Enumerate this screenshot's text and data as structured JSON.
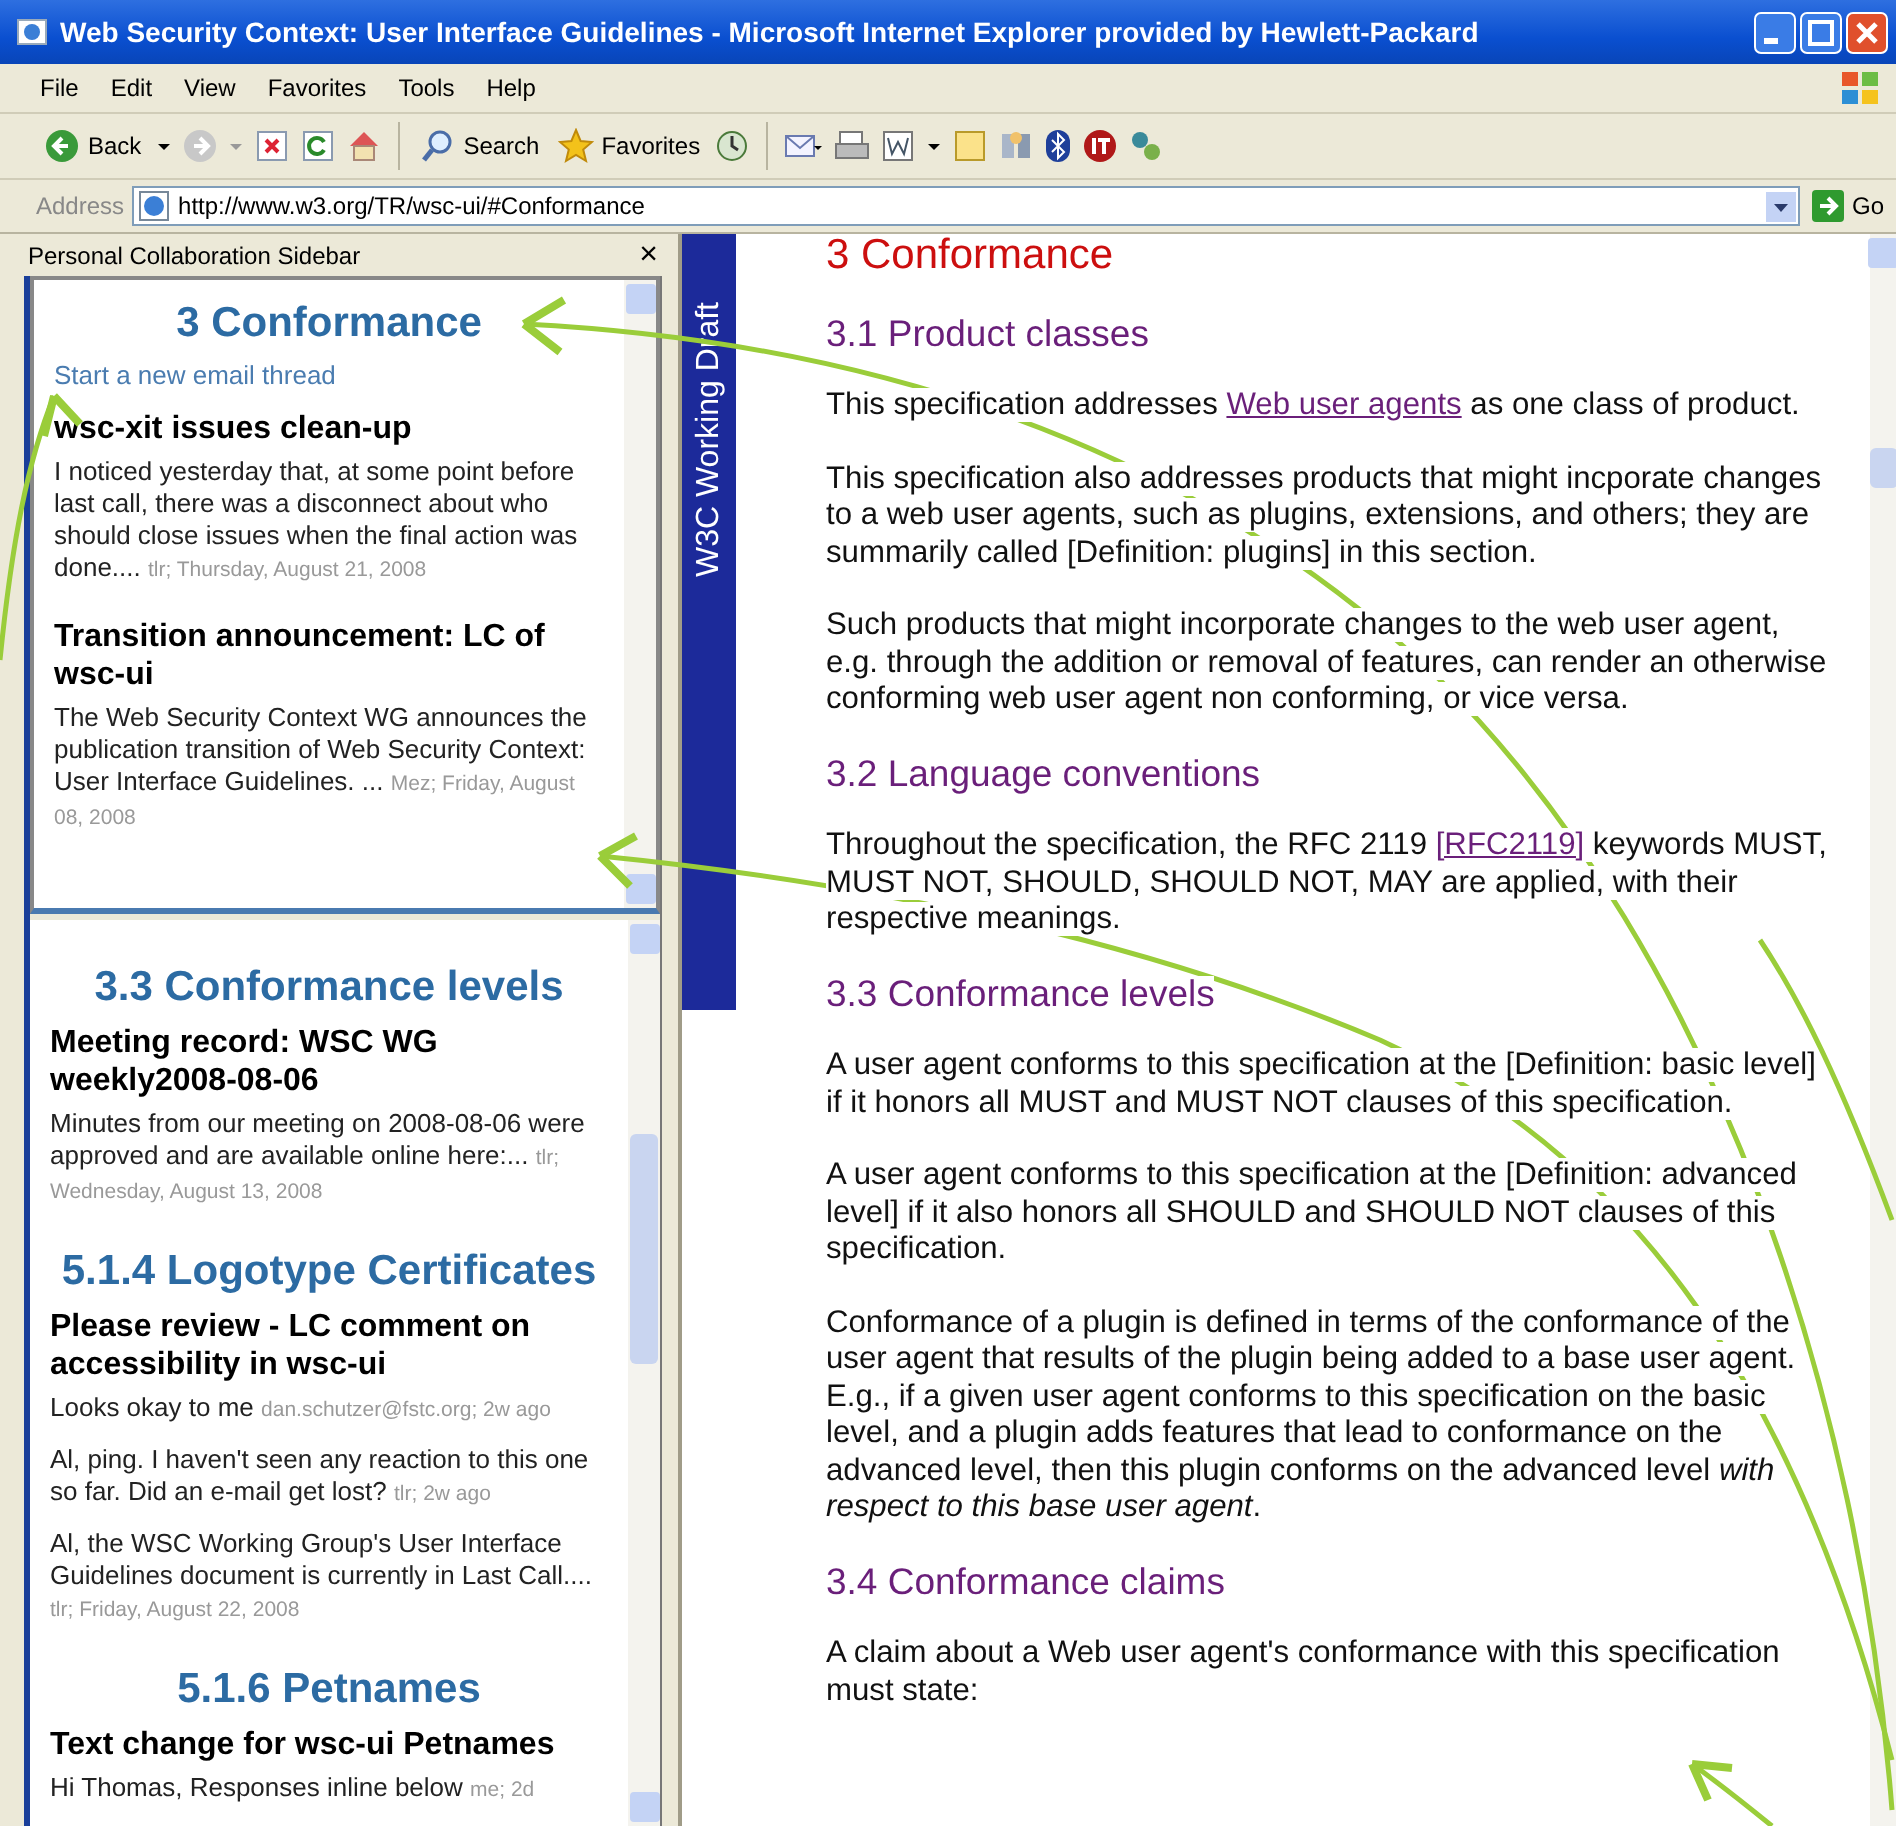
{
  "window": {
    "title": "Web Security Context: User Interface Guidelines - Microsoft Internet Explorer provided by Hewlett-Packard"
  },
  "menu_bar": [
    "File",
    "Edit",
    "View",
    "Favorites",
    "Tools",
    "Help"
  ],
  "toolbar": [
    {
      "kind": "back",
      "label": "Back"
    },
    {
      "kind": "search",
      "label": "Search"
    },
    {
      "kind": "favorites",
      "label": "Favorites"
    }
  ],
  "address_bar": {
    "label": "Address",
    "value": "http://www.w3.org/TR/wsc-ui/#Conformance",
    "go": "Go"
  },
  "sidebar": {
    "title": "Personal Collaboration Sidebar",
    "close": "×",
    "panes": [
      {
        "sections": [
          {
            "heading": "3 Conformance",
            "link": "Start a new email thread",
            "threads": [
              {
                "title": "wsc-xit issues clean-up",
                "messages": [
                  {
                    "text": "I noticed yesterday that, at some point before last call, there was a disconnect about who should close issues when the final action was done....",
                    "meta": "tlr; Thursday, August 21, 2008"
                  }
                ]
              },
              {
                "title": "Transition announcement: LC of wsc-ui",
                "messages": [
                  {
                    "text": "The Web Security Context WG announces the publication transition of Web Security Context: User Interface Guidelines. ...",
                    "meta": "Mez; Friday, August 08, 2008"
                  }
                ]
              }
            ]
          }
        ]
      },
      {
        "sections": [
          {
            "heading": "3.3 Conformance levels",
            "threads": [
              {
                "title": "Meeting record: WSC WG weekly2008-08-06",
                "messages": [
                  {
                    "text": "Minutes from our meeting on 2008-08-06 were approved and are available online here:...",
                    "meta": "tlr; Wednesday, August 13, 2008"
                  }
                ]
              }
            ]
          },
          {
            "heading": "5.1.4 Logotype Certificates",
            "threads": [
              {
                "title": "Please review - LC comment on accessibility in wsc-ui",
                "messages": [
                  {
                    "text": "Looks okay to me",
                    "meta": "dan.schutzer@fstc.org; 2w ago"
                  },
                  {
                    "text": "Al, ping. I haven't seen any reaction to this one so far. Did an e-mail get lost?",
                    "meta": "tlr; 2w ago"
                  },
                  {
                    "text": "Al, the WSC Working Group's User Interface Guidelines document is currently in Last Call....",
                    "meta": "tlr; Friday, August 22, 2008"
                  }
                ]
              }
            ]
          },
          {
            "heading": "5.1.6 Petnames",
            "threads": [
              {
                "title": "Text change for wsc-ui Petnames",
                "messages": [
                  {
                    "text": "Hi Thomas, Responses inline below",
                    "meta": "me; 2d"
                  }
                ]
              }
            ]
          }
        ]
      }
    ]
  },
  "document": {
    "band": "W3C Working Draft",
    "title": "3 Conformance",
    "sections": [
      {
        "heading": "3.1 Product classes",
        "paragraphs": [
          [
            {
              "kind": "text",
              "text": "This specification addresses "
            },
            {
              "kind": "link",
              "text": "Web user agents"
            },
            {
              "kind": "text",
              "text": " as one class of product."
            }
          ],
          [
            {
              "kind": "text",
              "text": "This specification also addresses products that might incporate changes to a web user agents, such as plugins, extensions, and others; they are summarily called [Definition: plugins] in this section."
            }
          ],
          [
            {
              "kind": "text",
              "text": "Such products that might incorporate changes to the web user agent, e.g. through the addition or removal of features, can render an otherwise conforming web user agent non conforming, or vice versa."
            }
          ]
        ]
      },
      {
        "heading": "3.2 Language conventions",
        "paragraphs": [
          [
            {
              "kind": "text",
              "text": "Throughout the specification, the RFC 2119 "
            },
            {
              "kind": "link",
              "text": "[RFC2119]"
            },
            {
              "kind": "text",
              "text": " keywords MUST, MUST NOT, SHOULD, SHOULD NOT, MAY are applied, with their respective meanings."
            }
          ]
        ]
      },
      {
        "heading": "3.3 Conformance levels",
        "paragraphs": [
          [
            {
              "kind": "text",
              "text": "A user agent conforms to this specification at the [Definition: basic level] if it honors all MUST and MUST NOT clauses of this specification."
            }
          ],
          [
            {
              "kind": "text",
              "text": "A user agent conforms to this specification at the [Definition: advanced level] if it also honors all SHOULD and SHOULD NOT clauses of this specification."
            }
          ],
          [
            {
              "kind": "text",
              "text": "Conformance of a plugin is defined in terms of the conformance of the user agent that results of the plugin being added to a base user agent. E.g., if a given user agent conforms to this specification on the basic level, and a plugin adds features that lead to conformance on the advanced level, then this plugin conforms on the advanced level *with respect to this base user agent*."
            }
          ]
        ]
      },
      {
        "heading": "3.4 Conformance claims",
        "paragraphs": [
          [
            {
              "kind": "text",
              "text": "A claim about a Web user agent's conformance with this specification must state:"
            }
          ]
        ]
      }
    ]
  }
}
